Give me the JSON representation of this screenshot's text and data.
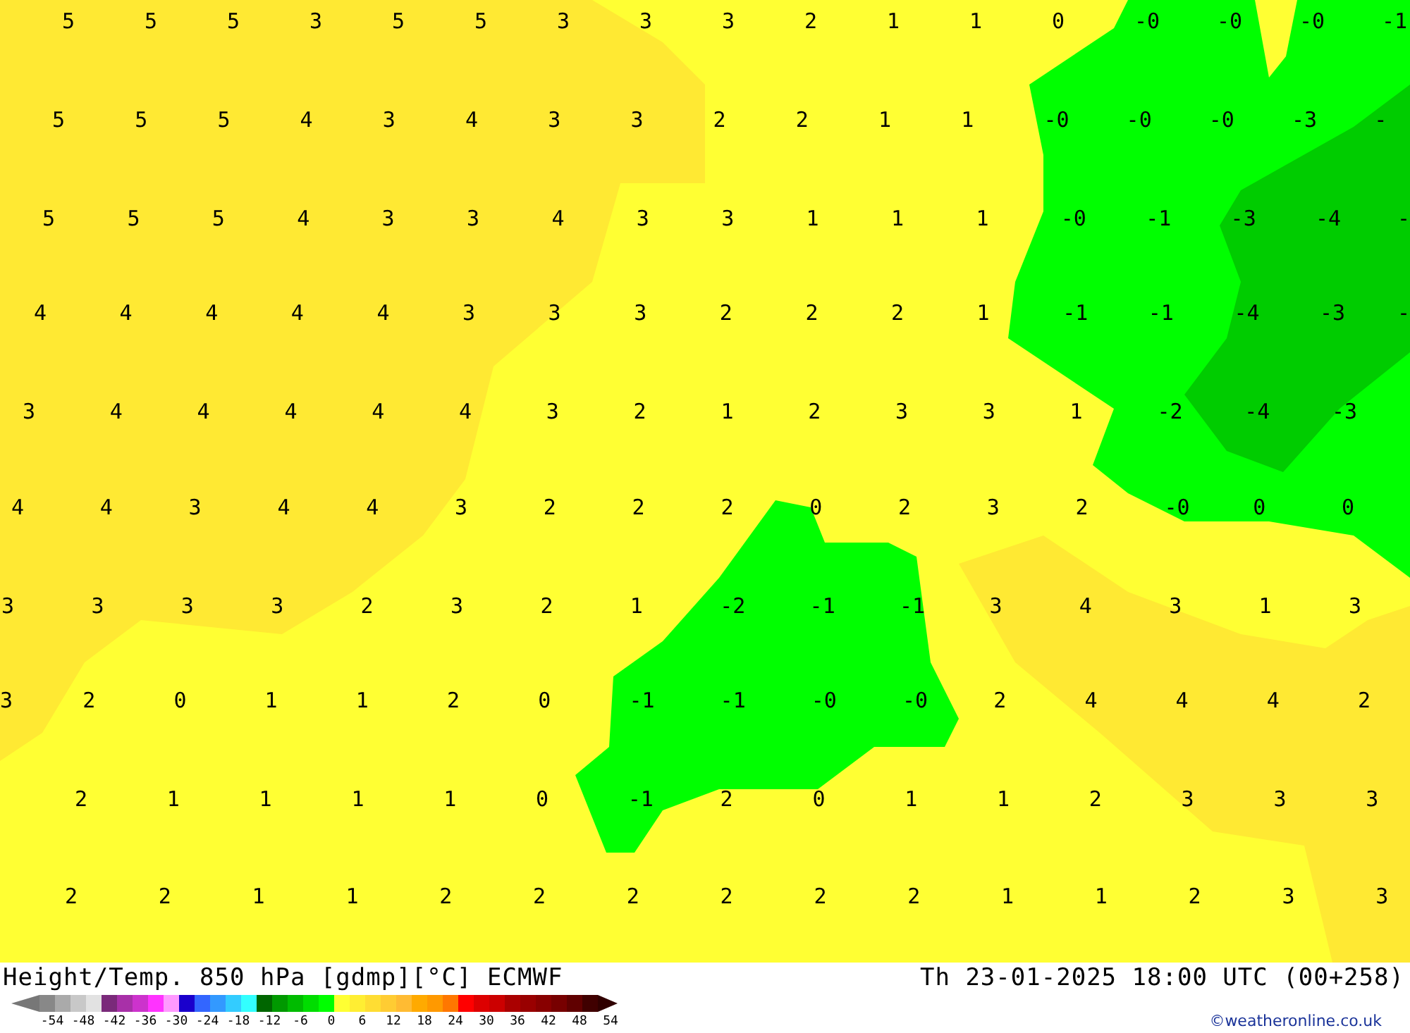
{
  "map": {
    "values": [
      [
        "5",
        "5",
        "5",
        "3",
        "5",
        "5",
        "3",
        "3",
        "3",
        "2",
        "1",
        "1",
        "0",
        "-0",
        "-0",
        "-0",
        "-1"
      ],
      [
        "5",
        "5",
        "5",
        "4",
        "3",
        "4",
        "3",
        "3",
        "2",
        "2",
        "1",
        "1",
        "-0",
        "-0",
        "-0",
        "-3",
        "-"
      ],
      [
        "5",
        "5",
        "5",
        "4",
        "3",
        "3",
        "4",
        "3",
        "3",
        "1",
        "1",
        "1",
        "-0",
        "-1",
        "-3",
        "-4",
        "-"
      ],
      [
        "4",
        "4",
        "4",
        "4",
        "4",
        "3",
        "3",
        "3",
        "2",
        "2",
        "2",
        "1",
        "-1",
        "-1",
        "-4",
        "-3",
        "-"
      ],
      [
        "3",
        "4",
        "4",
        "4",
        "4",
        "4",
        "3",
        "2",
        "1",
        "2",
        "3",
        "3",
        "1",
        "-2",
        "-4",
        "-3"
      ],
      [
        "4",
        "4",
        "3",
        "4",
        "4",
        "3",
        "2",
        "2",
        "2",
        "0",
        "2",
        "3",
        "2",
        "-0",
        "0",
        "0"
      ],
      [
        "3",
        "3",
        "3",
        "3",
        "2",
        "3",
        "2",
        "1",
        "-2",
        "-1",
        "-1",
        "3",
        "4",
        "3",
        "1",
        "3"
      ],
      [
        "3",
        "2",
        "0",
        "1",
        "1",
        "2",
        "0",
        "-1",
        "-1",
        "-0",
        "-0",
        "2",
        "4",
        "4",
        "4",
        "2"
      ],
      [
        "2",
        "1",
        "1",
        "1",
        "1",
        "0",
        "-1",
        "2",
        "0",
        "1",
        "1",
        "2",
        "3",
        "3",
        "3"
      ],
      [
        "2",
        "2",
        "1",
        "1",
        "2",
        "2",
        "2",
        "2",
        "2",
        "2",
        "1",
        "1",
        "2",
        "3",
        "3"
      ]
    ]
  },
  "footer": {
    "title": "Height/Temp. 850 hPa [gdmp][°C] ECMWF",
    "datetime": "Th 23-01-2025 18:00 UTC (00+258)",
    "scale_ticks": [
      "-54",
      "-48",
      "-42",
      "-36",
      "-30",
      "-24",
      "-18",
      "-12",
      "-6",
      "0",
      "6",
      "12",
      "18",
      "24",
      "30",
      "36",
      "42",
      "48",
      "54"
    ],
    "credit": "©weatheronline.co.uk"
  }
}
